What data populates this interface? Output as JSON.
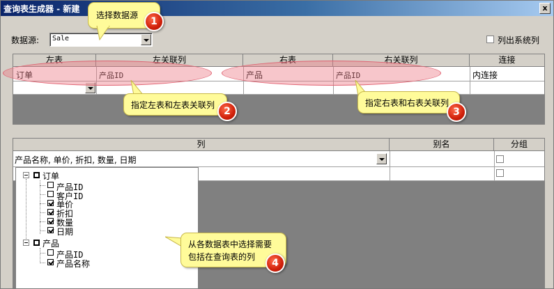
{
  "window": {
    "title": "查询表生成器 - 新建",
    "close_glyph": "x"
  },
  "datasource": {
    "label": "数据源:",
    "value": "Sale"
  },
  "options": {
    "show_system_columns": "列出系统列"
  },
  "join_grid": {
    "headers": [
      "左表",
      "左关联列",
      "右表",
      "右关联列",
      "连接"
    ],
    "rows": [
      {
        "left_table": "订单",
        "left_column": "产品ID",
        "right_table": "产品",
        "right_column": "产品ID",
        "join": "内连接"
      }
    ]
  },
  "columns_grid": {
    "headers": [
      "列",
      "别名",
      "分组"
    ],
    "selected_columns": "产品名称, 单价, 折扣, 数量, 日期"
  },
  "tree": {
    "tables": [
      {
        "name": "订单",
        "columns": [
          {
            "name": "产品ID",
            "checked": false
          },
          {
            "name": "客户ID",
            "checked": false
          },
          {
            "name": "单价",
            "checked": true
          },
          {
            "name": "折扣",
            "checked": true
          },
          {
            "name": "数量",
            "checked": true
          },
          {
            "name": "日期",
            "checked": true
          }
        ]
      },
      {
        "name": "产品",
        "columns": [
          {
            "name": "产品ID",
            "checked": false
          },
          {
            "name": "产品名称",
            "checked": true
          }
        ]
      }
    ]
  },
  "callouts": [
    {
      "num": "1",
      "text": "选择数据源"
    },
    {
      "num": "2",
      "text": "指定左表和左表关联列"
    },
    {
      "num": "3",
      "text": "指定右表和右表关联列"
    },
    {
      "num": "4",
      "text_line1": "从各数据表中选择需要",
      "text_line2": "包括在查询表的列"
    }
  ],
  "colors": {
    "title_start": "#0a246a",
    "title_end": "#a6caf0",
    "callout_bg": "#fffb9a",
    "badge": "#d0200a",
    "highlight": "#ec7882"
  }
}
